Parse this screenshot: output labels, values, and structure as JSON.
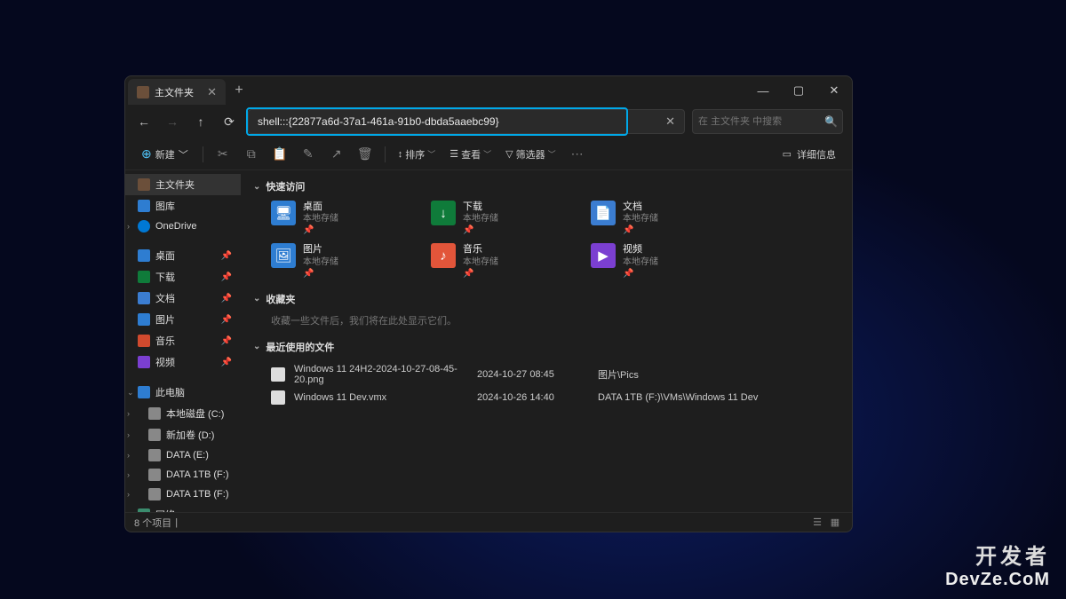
{
  "window": {
    "tab_title": "主文件夹",
    "new_tab": "+",
    "controls": {
      "min": "—",
      "max": "▢",
      "close": "✕"
    }
  },
  "nav": {
    "address_value": "shell:::{22877a6d-37a1-461a-91b0-dbda5aaebc99}",
    "search_placeholder": "在 主文件夹 中搜索"
  },
  "toolbar": {
    "new_label": "新建",
    "sort_label": "排序",
    "view_label": "查看",
    "filter_label": "筛选器",
    "details_label": "详细信息"
  },
  "sidebar": {
    "home": "主文件夹",
    "gallery": "图库",
    "onedrive": "OneDrive",
    "desktop": "桌面",
    "downloads": "下载",
    "documents": "文档",
    "pictures": "图片",
    "music": "音乐",
    "videos": "视频",
    "this_pc": "此电脑",
    "drives": [
      "本地磁盘 (C:)",
      "新加卷 (D:)",
      "DATA (E:)",
      "DATA 1TB (F:)",
      "DATA 1TB (F:)"
    ],
    "network": "网络"
  },
  "sections": {
    "quick_access": "快速访问",
    "favorites": "收藏夹",
    "favorites_empty": "收藏一些文件后，我们将在此处显示它们。",
    "recent": "最近使用的文件"
  },
  "quick_access": [
    {
      "name": "桌面",
      "sub": "本地存储",
      "color": "#2e7dd1",
      "glyph": "🖥"
    },
    {
      "name": "下载",
      "sub": "本地存储",
      "color": "#0f7b3a",
      "glyph": "↓"
    },
    {
      "name": "文档",
      "sub": "本地存储",
      "color": "#3b7dd1",
      "glyph": "📄"
    },
    {
      "name": "图片",
      "sub": "本地存储",
      "color": "#2e7dd1",
      "glyph": "🖼"
    },
    {
      "name": "音乐",
      "sub": "本地存储",
      "color": "#e2553a",
      "glyph": "♪"
    },
    {
      "name": "视频",
      "sub": "本地存储",
      "color": "#7b3fd1",
      "glyph": "▶"
    }
  ],
  "recent_files": [
    {
      "name": "Windows 11 24H2-2024-10-27-08-45-20.png",
      "date": "2024-10-27 08:45",
      "path": "图片\\Pics"
    },
    {
      "name": "Windows 11 Dev.vmx",
      "date": "2024-10-26 14:40",
      "path": "DATA 1TB (F:)\\VMs\\Windows 11 Dev"
    }
  ],
  "status": {
    "count": "8 个项目"
  },
  "watermark": {
    "cn": "开发者",
    "en": "DevZe.CoM"
  }
}
